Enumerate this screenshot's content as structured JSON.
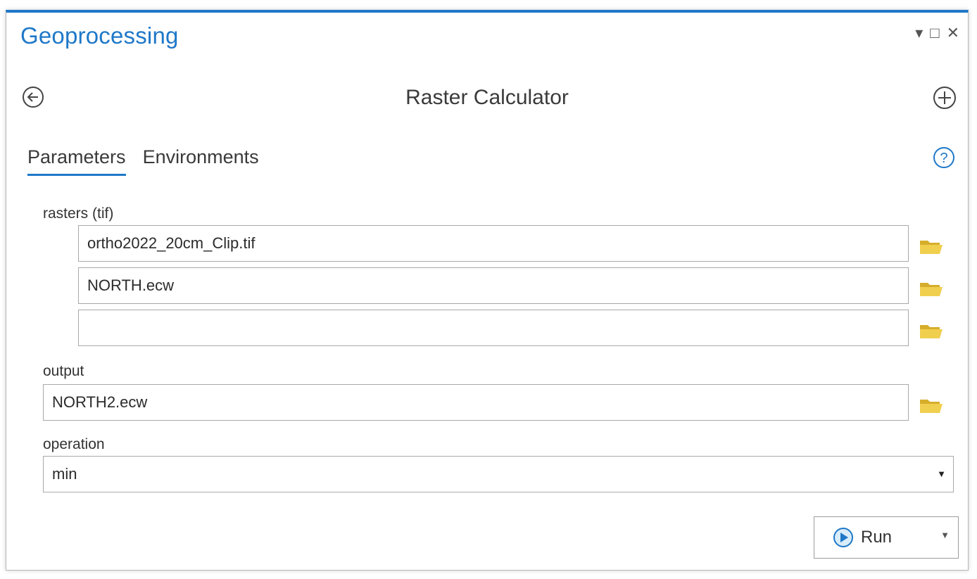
{
  "window": {
    "title": "Geoprocessing",
    "controls": {
      "pin": "▾",
      "maximize": "□",
      "close": "✕"
    }
  },
  "tool": {
    "title": "Raster Calculator"
  },
  "tabs": [
    {
      "label": "Parameters",
      "active": true
    },
    {
      "label": "Environments",
      "active": false
    }
  ],
  "params": {
    "rasters_label": "rasters (tif)",
    "rasters": [
      {
        "value": "ortho2022_20cm_Clip.tif"
      },
      {
        "value": "NORTH.ecw"
      },
      {
        "value": ""
      }
    ],
    "output_label": "output",
    "output_value": "NORTH2.ecw",
    "operation_label": "operation",
    "operation_value": "min"
  },
  "run": {
    "label": "Run"
  },
  "colors": {
    "accent": "#1f78c8",
    "folder": "#e8c53f"
  },
  "icons": [
    "back-icon",
    "add-icon",
    "help-icon",
    "folder-icon",
    "play-icon",
    "dropdown-caret-icon"
  ]
}
